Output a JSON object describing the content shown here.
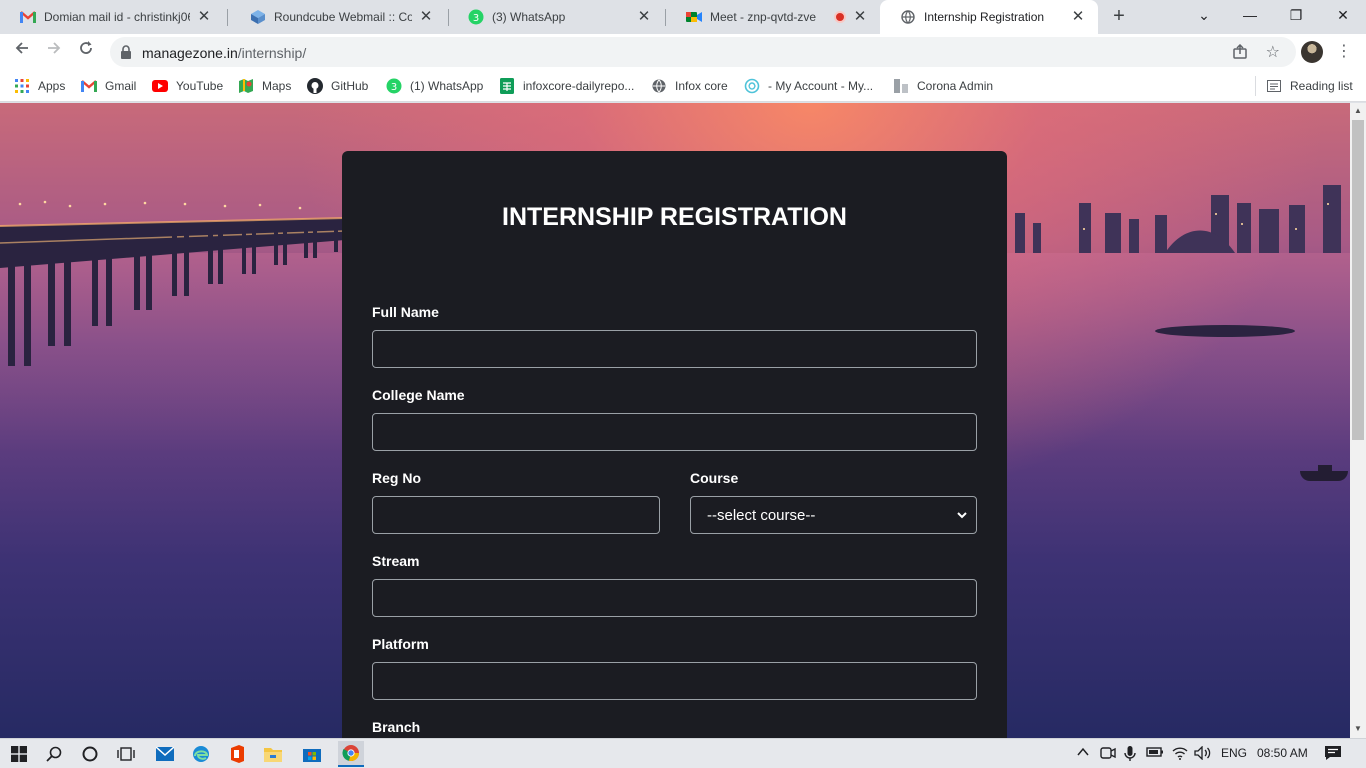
{
  "browser": {
    "tabs": [
      {
        "title": "Domian mail id - christinkj06@",
        "icon": "gmail-icon"
      },
      {
        "title": "Roundcube Webmail :: Comp",
        "icon": "roundcube-icon"
      },
      {
        "title": "(3) WhatsApp",
        "icon": "whatsapp-icon",
        "badge": "3"
      },
      {
        "title": "Meet - znp-qvtd-zve",
        "icon": "meet-icon"
      },
      {
        "title": "Internship Registration",
        "icon": "globe-icon",
        "active": true
      }
    ],
    "new_tab": "+",
    "window_controls": {
      "minimize": "—",
      "maximize": "❐",
      "close": "✕",
      "tab_search": "⌄"
    },
    "url_host": "managezone.in",
    "url_path": "/internship/",
    "bookmarks": [
      {
        "label": "Apps",
        "icon": "apps-grid-icon"
      },
      {
        "label": "Gmail",
        "icon": "gmail-icon"
      },
      {
        "label": "YouTube",
        "icon": "youtube-icon"
      },
      {
        "label": "Maps",
        "icon": "maps-icon"
      },
      {
        "label": "GitHub",
        "icon": "github-icon"
      },
      {
        "label": "(1) WhatsApp",
        "icon": "whatsapp-icon",
        "badge": "3"
      },
      {
        "label": "infoxcore-dailyrepo...",
        "icon": "sheets-icon"
      },
      {
        "label": "Infox core",
        "icon": "globe-icon"
      },
      {
        "label": "- My Account - My...",
        "icon": "account-icon"
      },
      {
        "label": "Corona Admin",
        "icon": "corona-icon"
      }
    ],
    "reading_list": "Reading list"
  },
  "form": {
    "title": "INTERNSHIP REGISTRATION",
    "full_name_label": "Full Name",
    "college_label": "College Name",
    "reg_no_label": "Reg No",
    "course_label": "Course",
    "course_selected": "--select course--",
    "stream_label": "Stream",
    "platform_label": "Platform",
    "branch_label": "Branch"
  },
  "taskbar": {
    "language": "ENG",
    "time": "08:50 AM"
  },
  "colors": {
    "card_bg": "#1b1c22",
    "field_border": "#9aa0a6",
    "tabstrip_bg": "#dee1e6"
  }
}
